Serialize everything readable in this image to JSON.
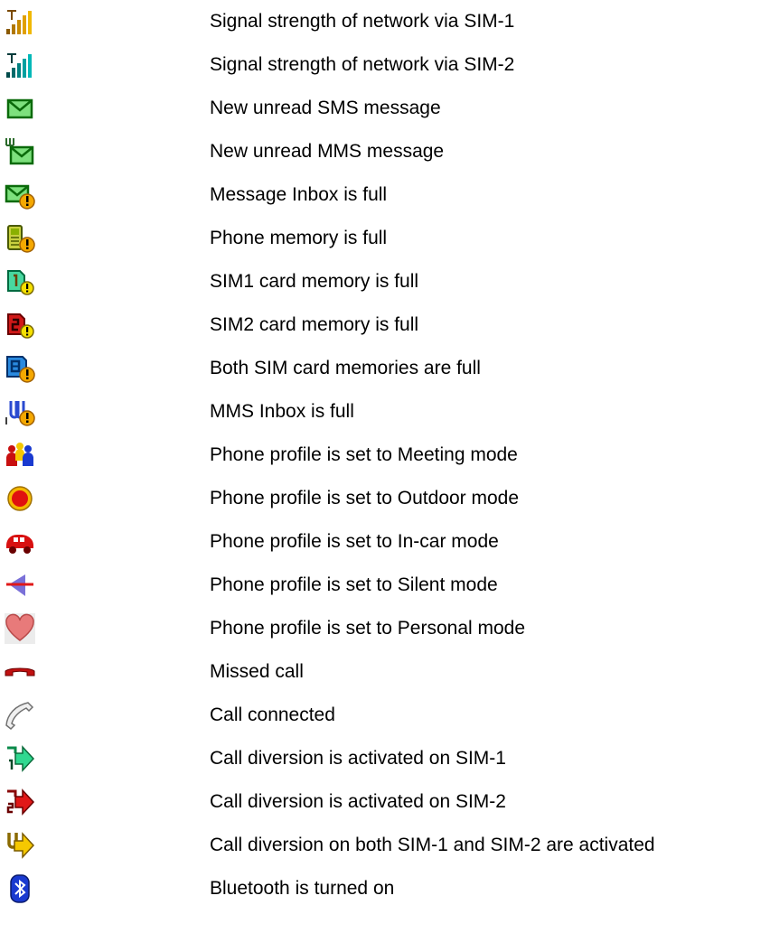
{
  "legend": {
    "items": [
      {
        "icon": "signal-sim1-icon",
        "text": "Signal strength of network via SIM-1"
      },
      {
        "icon": "signal-sim2-icon",
        "text": "Signal strength of network via SIM-2"
      },
      {
        "icon": "sms-unread-icon",
        "text": "New unread SMS message"
      },
      {
        "icon": "mms-unread-icon",
        "text": "New unread MMS message"
      },
      {
        "icon": "message-inbox-full-icon",
        "text": "Message Inbox is full"
      },
      {
        "icon": "phone-memory-full-icon",
        "text": "Phone memory is full"
      },
      {
        "icon": "sim1-memory-full-icon",
        "text": "SIM1 card memory is full"
      },
      {
        "icon": "sim2-memory-full-icon",
        "text": "SIM2 card memory is full"
      },
      {
        "icon": "both-sim-memory-full-icon",
        "text": "Both SIM card memories are full"
      },
      {
        "icon": "mms-inbox-full-icon",
        "text": "MMS Inbox is full"
      },
      {
        "icon": "meeting-mode-icon",
        "text": "Phone profile is set to Meeting mode"
      },
      {
        "icon": "outdoor-mode-icon",
        "text": "Phone profile is set to Outdoor mode"
      },
      {
        "icon": "in-car-mode-icon",
        "text": "Phone profile is set to In-car mode"
      },
      {
        "icon": "silent-mode-icon",
        "text": "Phone profile is set to Silent mode"
      },
      {
        "icon": "personal-mode-icon",
        "text": "Phone profile is set to Personal mode"
      },
      {
        "icon": "missed-call-icon",
        "text": "Missed call"
      },
      {
        "icon": "call-connected-icon",
        "text": "Call connected"
      },
      {
        "icon": "call-divert-sim1-icon",
        "text": "Call diversion is activated on SIM-1"
      },
      {
        "icon": "call-divert-sim2-icon",
        "text": "Call diversion is activated on SIM-2"
      },
      {
        "icon": "call-divert-both-icon",
        "text": "Call diversion on both SIM-1 and SIM-2 are activated"
      },
      {
        "icon": "bluetooth-icon",
        "text": "Bluetooth is turned on"
      }
    ]
  }
}
